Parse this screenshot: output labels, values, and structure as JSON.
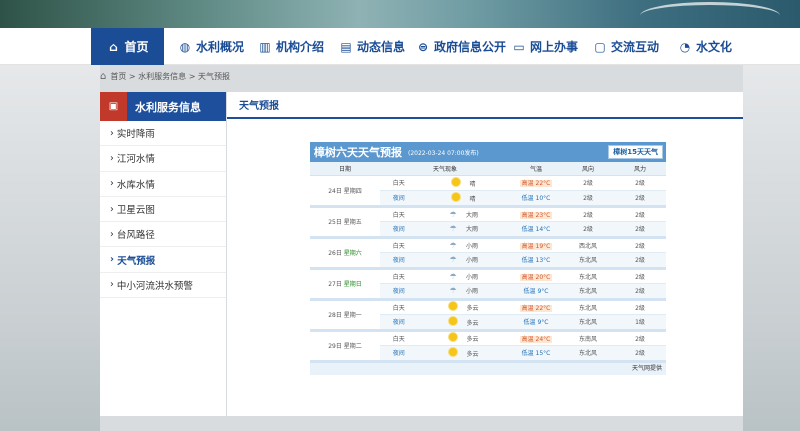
{
  "nav": {
    "items": [
      {
        "label": "首页",
        "icon": "home-icon"
      },
      {
        "label": "水利概况",
        "icon": "globe-icon"
      },
      {
        "label": "机构介绍",
        "icon": "building-icon"
      },
      {
        "label": "动态信息",
        "icon": "news-icon"
      },
      {
        "label": "政府信息公开",
        "icon": "info-icon"
      },
      {
        "label": "网上办事",
        "icon": "monitor-icon"
      },
      {
        "label": "交流互动",
        "icon": "chat-icon"
      },
      {
        "label": "水文化",
        "icon": "drop-icon"
      }
    ]
  },
  "breadcrumb": {
    "items": [
      "首页",
      ">",
      "水利服务信息",
      ">",
      "天气预报"
    ]
  },
  "sidebar": {
    "title": "水利服务信息",
    "items": [
      {
        "label": "实时降雨"
      },
      {
        "label": "江河水情"
      },
      {
        "label": "水库水情"
      },
      {
        "label": "卫星云图"
      },
      {
        "label": "台风路径"
      },
      {
        "label": "天气预报",
        "active": true
      },
      {
        "label": "中小河流洪水预警"
      }
    ]
  },
  "main": {
    "tab": "天气预报"
  },
  "weather": {
    "title": "樟树六天天气预报",
    "published": "(2022-03-24 07:00发布)",
    "button15": "樟树15天天气",
    "headers": [
      "日期",
      "天气现象",
      "气温",
      "风向",
      "风力"
    ],
    "days": [
      {
        "date": "24日",
        "week": "星期四",
        "weekend": false,
        "day": {
          "label": "白天",
          "icon": "sun",
          "weather": "晴",
          "tempLabel": "高温",
          "temp": "22°C",
          "wind": "2级",
          "windDir": "2级"
        },
        "night": {
          "label": "夜间",
          "icon": "sun",
          "weather": "晴",
          "tempLabel": "低温",
          "temp": "10°C",
          "wind": "2级",
          "windDir": "2级"
        }
      },
      {
        "date": "25日",
        "week": "星期五",
        "weekend": false,
        "day": {
          "label": "白天",
          "icon": "rain",
          "weather": "大雨",
          "tempLabel": "高温",
          "temp": "23°C",
          "wind": "2级",
          "windDir": "2级"
        },
        "night": {
          "label": "夜间",
          "icon": "rain",
          "weather": "大雨",
          "tempLabel": "低温",
          "temp": "14°C",
          "wind": "2级",
          "windDir": "2级"
        }
      },
      {
        "date": "26日",
        "week": "星期六",
        "weekend": true,
        "day": {
          "label": "白天",
          "icon": "rain",
          "weather": "小雨",
          "tempLabel": "高温",
          "temp": "19°C",
          "wind": "西北风",
          "windDir": "2级"
        },
        "night": {
          "label": "夜间",
          "icon": "rain",
          "weather": "小雨",
          "tempLabel": "低温",
          "temp": "13°C",
          "wind": "东北风",
          "windDir": "2级"
        }
      },
      {
        "date": "27日",
        "week": "星期日",
        "weekend": true,
        "day": {
          "label": "白天",
          "icon": "rain",
          "weather": "小雨",
          "tempLabel": "高温",
          "temp": "20°C",
          "wind": "东北风",
          "windDir": "2级"
        },
        "night": {
          "label": "夜间",
          "icon": "rain",
          "weather": "小雨",
          "tempLabel": "低温",
          "temp": "9°C",
          "wind": "东北风",
          "windDir": "2级"
        }
      },
      {
        "date": "28日",
        "week": "星期一",
        "weekend": false,
        "day": {
          "label": "白天",
          "icon": "cloud-sun",
          "weather": "多云",
          "tempLabel": "高温",
          "temp": "22°C",
          "wind": "东北风",
          "windDir": "2级"
        },
        "night": {
          "label": "夜间",
          "icon": "cloud-sun",
          "weather": "多云",
          "tempLabel": "低温",
          "temp": "9°C",
          "wind": "东北风",
          "windDir": "1级"
        }
      },
      {
        "date": "29日",
        "week": "星期二",
        "weekend": false,
        "day": {
          "label": "白天",
          "icon": "cloud-sun",
          "weather": "多云",
          "tempLabel": "高温",
          "temp": "24°C",
          "wind": "东南风",
          "windDir": "2级"
        },
        "night": {
          "label": "夜间",
          "icon": "cloud-sun",
          "weather": "多云",
          "tempLabel": "低温",
          "temp": "15°C",
          "wind": "东北风",
          "windDir": "2级"
        }
      }
    ],
    "footer": "天气网提供"
  }
}
